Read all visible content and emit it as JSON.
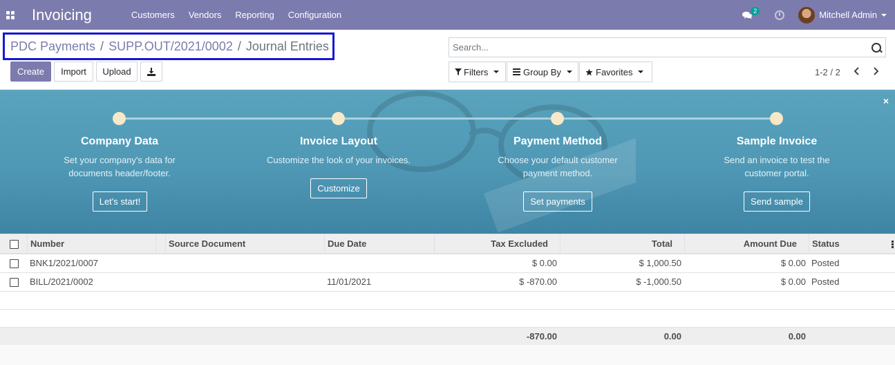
{
  "navbar": {
    "app_name": "Invoicing",
    "menu": [
      "Customers",
      "Vendors",
      "Reporting",
      "Configuration"
    ],
    "chat_count": "2",
    "user": "Mitchell Admin"
  },
  "breadcrumb": {
    "items": [
      "PDC Payments",
      "SUPP.OUT/2021/0002"
    ],
    "current": "Journal Entries",
    "separator": "/"
  },
  "toolbar": {
    "create": "Create",
    "import": "Import",
    "upload": "Upload"
  },
  "search": {
    "placeholder": "Search..."
  },
  "filters": {
    "filters": "Filters",
    "group_by": "Group By",
    "favorites": "Favorites"
  },
  "pager": {
    "label": "1-2 / 2"
  },
  "onboarding": {
    "steps": [
      {
        "title": "Company Data",
        "desc1": "Set your company's data for",
        "desc2": "documents header/footer.",
        "button": "Let's start!"
      },
      {
        "title": "Invoice Layout",
        "desc1": "Customize the look of your invoices.",
        "desc2": "",
        "button": "Customize"
      },
      {
        "title": "Payment Method",
        "desc1": "Choose your default customer",
        "desc2": "payment method.",
        "button": "Set payments"
      },
      {
        "title": "Sample Invoice",
        "desc1": "Send an invoice to test the",
        "desc2": "customer portal.",
        "button": "Send sample"
      }
    ],
    "close": "×"
  },
  "table": {
    "columns": [
      "Number",
      "Source Document",
      "Due Date",
      "Tax Excluded",
      "Total",
      "Amount Due",
      "Status"
    ],
    "rows": [
      {
        "number": "BNK1/2021/0007",
        "source": "",
        "due_date": "",
        "tax_excluded": "$ 0.00",
        "total": "$ 1,000.50",
        "amount_due": "$ 0.00",
        "status": "Posted"
      },
      {
        "number": "BILL/2021/0002",
        "source": "",
        "due_date": "11/01/2021",
        "tax_excluded": "$ -870.00",
        "total": "$ -1,000.50",
        "amount_due": "$ 0.00",
        "status": "Posted"
      }
    ],
    "totals": {
      "tax_excluded": "-870.00",
      "total": "0.00",
      "amount_due": "0.00"
    }
  },
  "colors": {
    "brand": "#7c7bad",
    "banner": "#4f98b5",
    "highlight_border": "#1616d4"
  }
}
